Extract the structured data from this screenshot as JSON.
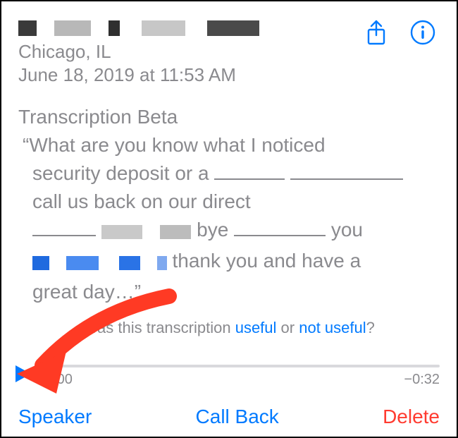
{
  "header": {
    "caller_name": "████ ████ ████",
    "location": "Chicago, IL",
    "datetime": "June 18, 2019 at 11:53 AM"
  },
  "transcription": {
    "section_label": "Transcription Beta",
    "open_quote": "“",
    "line1": "What are you know what I noticed",
    "line2a": "security deposit or a ",
    "line3": "call us back on our direct",
    "line4_bye": " bye ",
    "line4_you": " you",
    "line5_tail": " thank you and have a",
    "line6": "great day…”"
  },
  "feedback": {
    "prefix": "Was this transcription ",
    "useful": "useful",
    "or": " or ",
    "not_useful": "not useful",
    "q": "?"
  },
  "playback": {
    "elapsed": "0:00",
    "remaining": "−0:32"
  },
  "actions": {
    "speaker": "Speaker",
    "callback": "Call Back",
    "delete": "Delete"
  }
}
